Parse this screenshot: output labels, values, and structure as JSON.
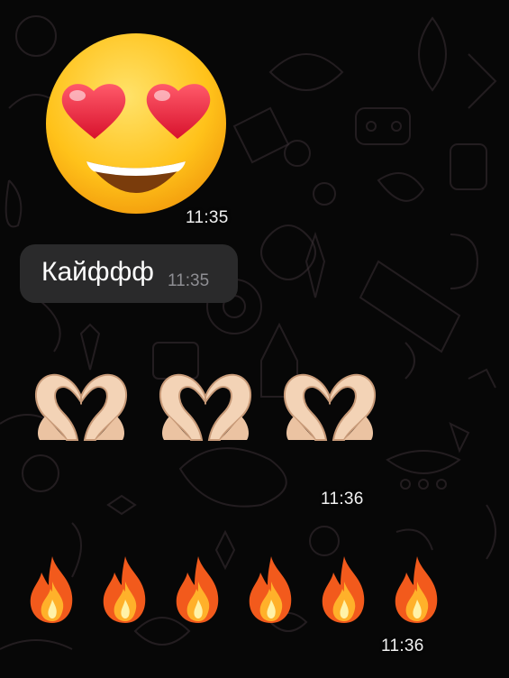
{
  "messages": [
    {
      "type": "emoji",
      "emoji": "heart-eyes-face",
      "time": "11:35"
    },
    {
      "type": "text",
      "text": "Кайффф",
      "time": "11:35"
    },
    {
      "type": "emoji-row",
      "emoji": "heart-hands",
      "count": 3,
      "time": "11:36"
    },
    {
      "type": "emoji-row",
      "emoji": "fire",
      "count": 6,
      "time": "11:36"
    }
  ],
  "colors": {
    "background": "#070707",
    "bubble": "#2a2a2b",
    "text": "#ffffff",
    "time_in_bubble": "#8e8e93",
    "doodle": "#3a2f35"
  }
}
